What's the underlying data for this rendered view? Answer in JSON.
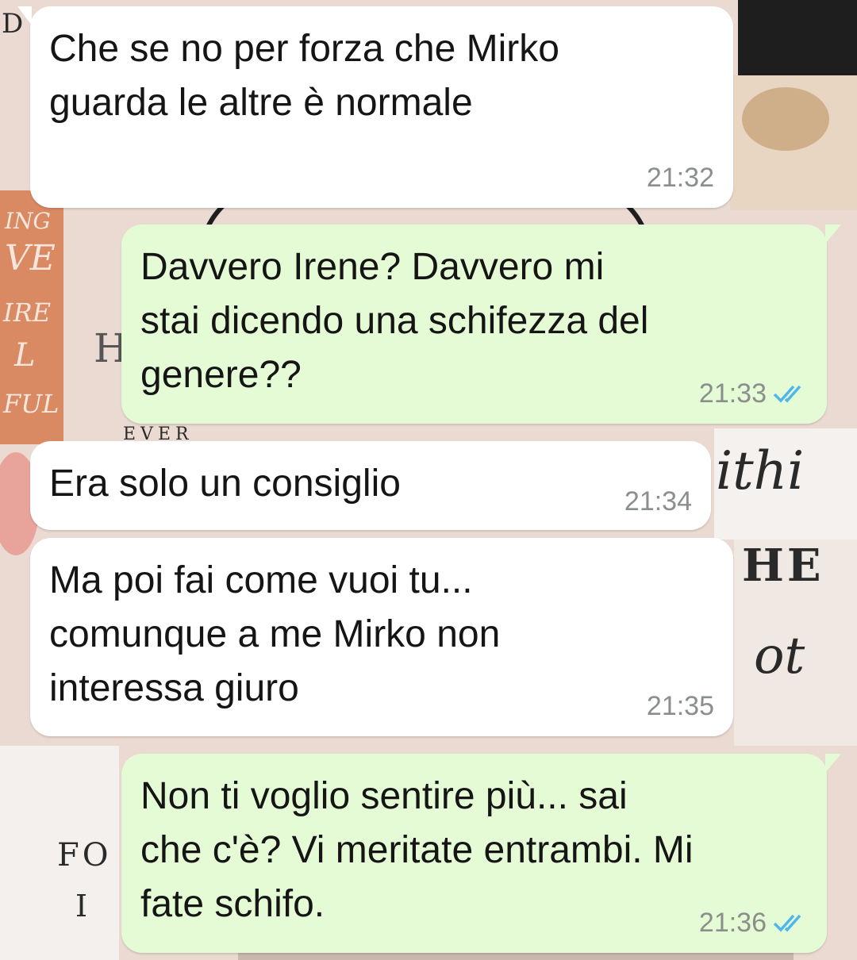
{
  "wallpaper": {
    "fragments": [
      "D",
      "ING",
      "VE",
      "IRE",
      "L",
      "FUL",
      "H",
      "FO",
      "I",
      "ithi",
      "HE",
      "ot",
      "EVER"
    ],
    "colors": {
      "pink": "#f0d0c4",
      "beige": "#e6d3c3",
      "dark": "#2a2a2a",
      "rose": "#e8a39a"
    }
  },
  "messages": [
    {
      "direction": "incoming",
      "text": "Che se no per forza che Mirko\nguarda le altre è normale",
      "time": "21:32",
      "ticks": null
    },
    {
      "direction": "outgoing",
      "text": "Davvero Irene? Davvero mi\nstai dicendo una schifezza del\ngenere??",
      "time": "21:33",
      "ticks": "double-check-icon"
    },
    {
      "direction": "incoming",
      "text": "Era solo un consiglio",
      "time": "21:34",
      "ticks": null
    },
    {
      "direction": "incoming",
      "text": "Ma poi fai come vuoi tu...\ncomunque a me Mirko non\ninteressa giuro",
      "time": "21:35",
      "ticks": null
    },
    {
      "direction": "outgoing",
      "text": "Non ti voglio sentire più... sai\nche c'è? Vi meritate entrambi. Mi\nfate schifo.",
      "time": "21:36",
      "ticks": "double-check-icon"
    }
  ],
  "colors": {
    "incoming_bubble": "#ffffff",
    "outgoing_bubble": "#e5fbd5",
    "timestamp": "#8b8f8c",
    "read_ticks": "#4fb6ec"
  }
}
